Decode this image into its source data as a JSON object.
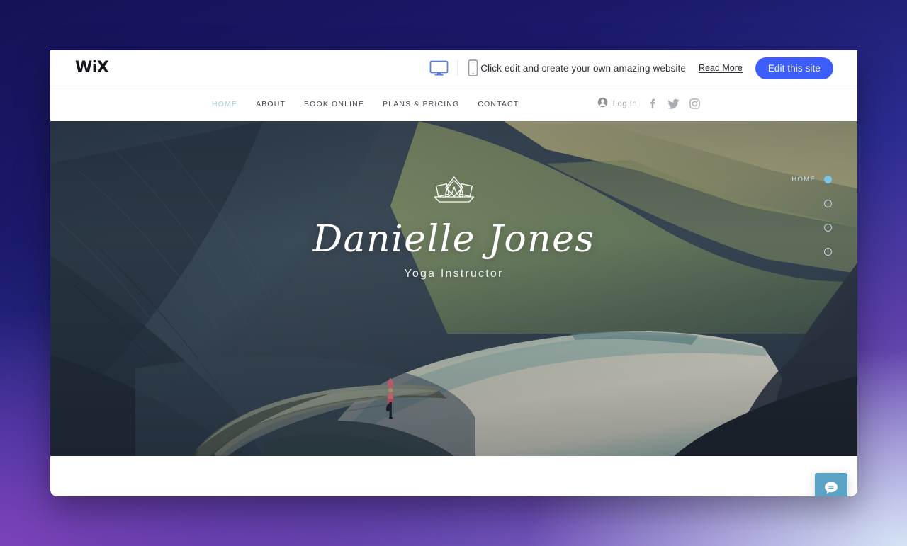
{
  "wix_bar": {
    "logo": "WiX",
    "devices": [
      {
        "name": "desktop-view-toggle",
        "icon": "desktop-icon",
        "active": true
      },
      {
        "name": "mobile-view-toggle",
        "icon": "mobile-icon",
        "active": false
      }
    ],
    "message": "Click edit and create your own amazing website",
    "read_more": "Read More",
    "edit_button": "Edit this site",
    "accent_color": "#3e5efb"
  },
  "site_nav": {
    "links": [
      {
        "label": "HOME",
        "active": true
      },
      {
        "label": "ABOUT",
        "active": false
      },
      {
        "label": "BOOK ONLINE",
        "active": false
      },
      {
        "label": "PLANS & PRICING",
        "active": false
      },
      {
        "label": "CONTACT",
        "active": false
      }
    ],
    "active_color": "#a8cfdd",
    "login_label": "Log In",
    "social": [
      "facebook-icon",
      "twitter-icon",
      "instagram-icon"
    ]
  },
  "hero": {
    "logo_icon": "lotus-logo-icon",
    "title": "Danielle Jones",
    "subtitle": "Yoga Instructor",
    "background": "mountain-fjord-photo"
  },
  "page_dots": [
    {
      "label": "HOME",
      "state": "filled"
    },
    {
      "label": "",
      "state": "hollow"
    },
    {
      "label": "",
      "state": "hollow"
    },
    {
      "label": "",
      "state": "hollow"
    }
  ],
  "chat": {
    "icon": "chat-bubble-icon",
    "color": "#5ba3c4"
  }
}
